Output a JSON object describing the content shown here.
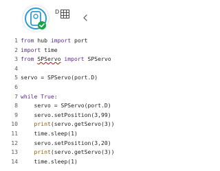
{
  "header": {
    "port_letter": "D",
    "hub_icon": "servo-motor-icon",
    "status_icon": "check-icon",
    "grid_icon": "port-grid-icon",
    "chevron_icon": "chevron-left-icon",
    "accent_color": "#2a9bd6",
    "status_color": "#18a24a"
  },
  "editor": {
    "lines": [
      {
        "n": "1",
        "tokens": [
          {
            "t": "from",
            "c": "kw"
          },
          {
            "t": " hub "
          },
          {
            "t": "import",
            "c": "kw"
          },
          {
            "t": " port"
          }
        ]
      },
      {
        "n": "2",
        "tokens": [
          {
            "t": "import",
            "c": "kw"
          },
          {
            "t": " time"
          }
        ]
      },
      {
        "n": "3",
        "tokens": [
          {
            "t": "from",
            "c": "kw"
          },
          {
            "t": " "
          },
          {
            "t": "SPServo",
            "c": "squiggle"
          },
          {
            "t": " "
          },
          {
            "t": "import",
            "c": "kw"
          },
          {
            "t": " SPServo"
          }
        ]
      },
      {
        "n": "4",
        "tokens": []
      },
      {
        "n": "5",
        "tokens": [
          {
            "t": "servo = SPServo(port.D)"
          }
        ]
      },
      {
        "n": "6",
        "tokens": []
      },
      {
        "n": "7",
        "tokens": [
          {
            "t": "while",
            "c": "kw"
          },
          {
            "t": " "
          },
          {
            "t": "True",
            "c": "kw"
          },
          {
            "t": ":"
          }
        ]
      },
      {
        "n": "8",
        "tokens": [
          {
            "t": "    servo = SPServo(port.D)"
          }
        ]
      },
      {
        "n": "9",
        "tokens": [
          {
            "t": "    servo.setPosition(3,99)"
          }
        ]
      },
      {
        "n": "10",
        "tokens": [
          {
            "t": "    "
          },
          {
            "t": "print",
            "c": "fn"
          },
          {
            "t": "(servo.getServo(3))"
          }
        ]
      },
      {
        "n": "11",
        "tokens": [
          {
            "t": "    time.sleep(1)"
          }
        ]
      },
      {
        "n": "12",
        "tokens": [
          {
            "t": "    servo.setPosition(3,20)"
          }
        ]
      },
      {
        "n": "13",
        "tokens": [
          {
            "t": "    "
          },
          {
            "t": "print",
            "c": "fn"
          },
          {
            "t": "(servo.getServo(3))"
          }
        ]
      },
      {
        "n": "14",
        "tokens": [
          {
            "t": "    time.sleep(1)"
          }
        ]
      }
    ]
  }
}
